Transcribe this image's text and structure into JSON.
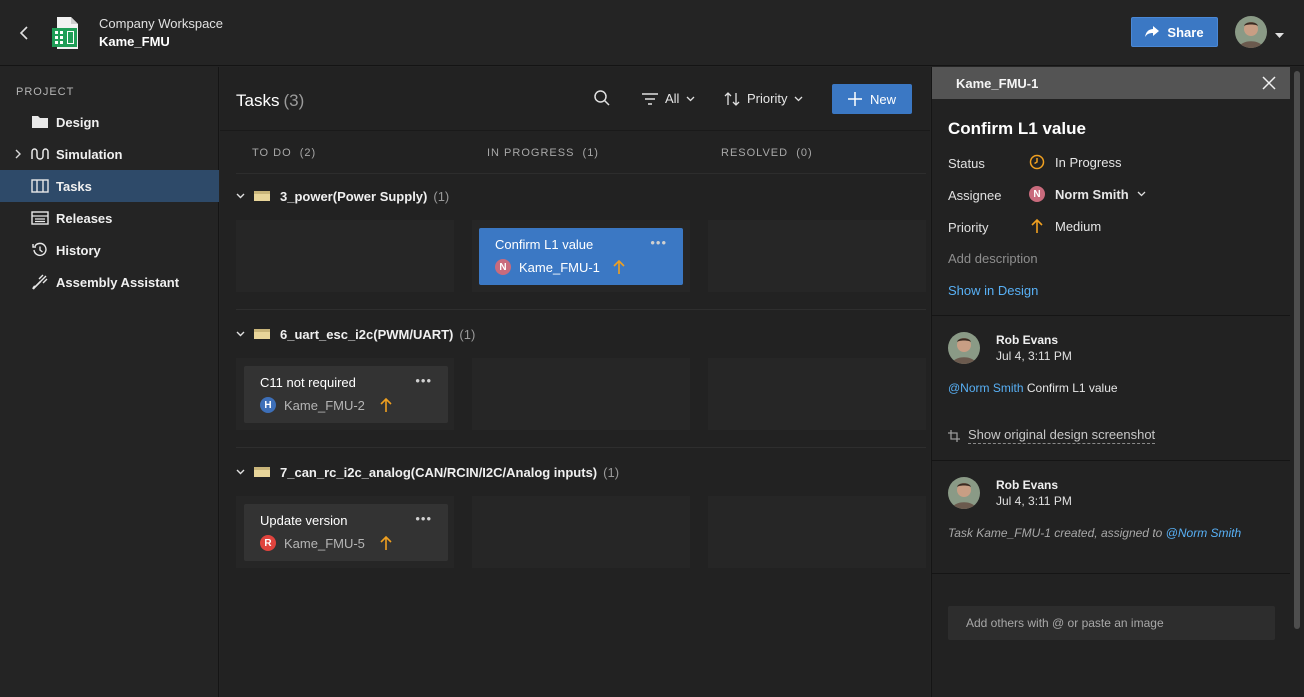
{
  "header": {
    "workspace": "Company Workspace",
    "project": "Kame_FMU",
    "share_label": "Share"
  },
  "sidebar": {
    "heading": "PROJECT",
    "items": [
      {
        "label": "Design",
        "icon": "folder-icon"
      },
      {
        "label": "Simulation",
        "icon": "simulation-wave-icon"
      },
      {
        "label": "Tasks",
        "icon": "tasks-board-icon",
        "active": true
      },
      {
        "label": "Releases",
        "icon": "releases-icon"
      },
      {
        "label": "History",
        "icon": "history-icon"
      },
      {
        "label": "Assembly Assistant",
        "icon": "assembly-tool-icon"
      }
    ]
  },
  "main": {
    "title": "Tasks",
    "count": "(3)",
    "filter_label": "All",
    "sort_label": "Priority",
    "new_label": "New",
    "columns": [
      {
        "name": "TO DO",
        "count": "(2)"
      },
      {
        "name": "IN PROGRESS",
        "count": "(1)"
      },
      {
        "name": "RESOLVED",
        "count": "(0)"
      }
    ],
    "groups": [
      {
        "name": "3_power(Power Supply)",
        "count": "(1)",
        "card": {
          "title": "Confirm L1 value",
          "id": "Kame_FMU-1",
          "badge": "N",
          "badge_color": "#c96b7d",
          "column": "IN PROGRESS",
          "priority": "Medium",
          "selected": true
        }
      },
      {
        "name": "6_uart_esc_i2c(PWM/UART)",
        "count": "(1)",
        "card": {
          "title": "C11 not required",
          "id": "Kame_FMU-2",
          "badge": "H",
          "badge_color": "#3d6fb8",
          "column": "TO DO",
          "priority": "Medium"
        }
      },
      {
        "name": "7_can_rc_i2c_analog(CAN/RCIN/I2C/Analog inputs)",
        "count": "(1)",
        "card": {
          "title": "Update version",
          "id": "Kame_FMU-5",
          "badge": "R",
          "badge_color": "#e0443e",
          "column": "TO DO",
          "priority": "Medium"
        }
      }
    ]
  },
  "panel": {
    "task_id": "Kame_FMU-1",
    "title": "Confirm L1 value",
    "status_label": "Status",
    "status_value": "In Progress",
    "assignee_label": "Assignee",
    "assignee_badge": "N",
    "assignee_value": "Norm Smith",
    "priority_label": "Priority",
    "priority_value": "Medium",
    "add_description": "Add description",
    "show_in_design": "Show in Design",
    "comments": [
      {
        "author": "Rob Evans",
        "time": "Jul 4, 3:11 PM",
        "mention": "@Norm Smith",
        "text": " Confirm L1 value",
        "action": "Show original design screenshot"
      },
      {
        "author": "Rob Evans",
        "time": "Jul 4, 3:11 PM",
        "text": "Task Kame_FMU-1 created, assigned to ",
        "mention": "@Norm Smith"
      }
    ],
    "input_placeholder": "Add others with @ or paste an image"
  },
  "colors": {
    "accent": "#3b78c4",
    "priority_medium": "#f0a020",
    "link": "#58b0f5",
    "active_nav": "#2e4a69"
  }
}
